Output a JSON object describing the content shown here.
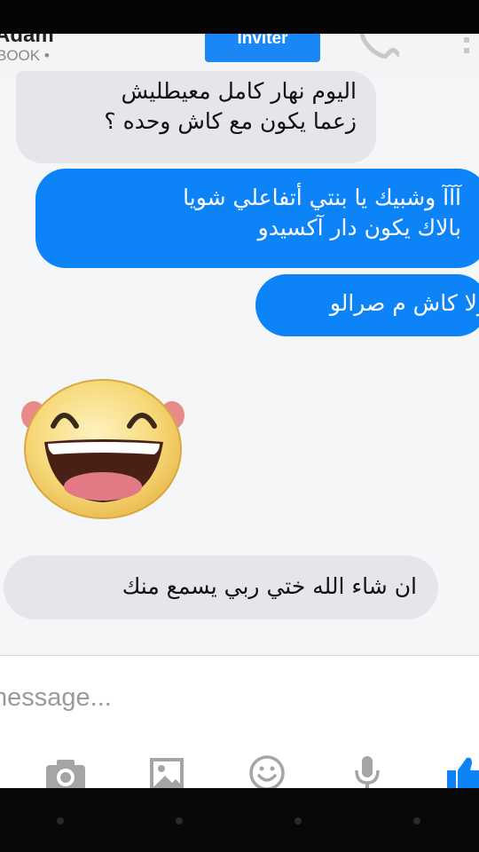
{
  "header": {
    "contact_name": "Adam",
    "contact_subtitle": "BOOK •",
    "invite_label": "Inviter"
  },
  "messages": [
    {
      "direction": "incoming",
      "lines": [
        "اليوم نهار كامل معيطليش",
        "زعما يكون مع كاش وحده ؟"
      ]
    },
    {
      "direction": "outgoing",
      "lines": [
        "آآآ وشبيك يا بنتي أتفاعلي شويا",
        "بالاك يكون دار آكسيدو"
      ]
    },
    {
      "direction": "outgoing",
      "lines": [
        "ولا كاش م صرالو"
      ]
    },
    {
      "direction": "incoming",
      "type": "sticker",
      "sticker": "laughing-face"
    },
    {
      "direction": "incoming",
      "lines": [
        "ان شاء الله ختي ربي يسمع منك"
      ]
    }
  ],
  "composer": {
    "placeholder": "message...",
    "tools": [
      "camera-icon",
      "image-icon",
      "smiley-icon",
      "mic-icon",
      "like-icon"
    ]
  },
  "colors": {
    "accent": "#0c84f7",
    "incoming_bubble": "#e5e5ea",
    "outgoing_text": "#ffffff"
  }
}
